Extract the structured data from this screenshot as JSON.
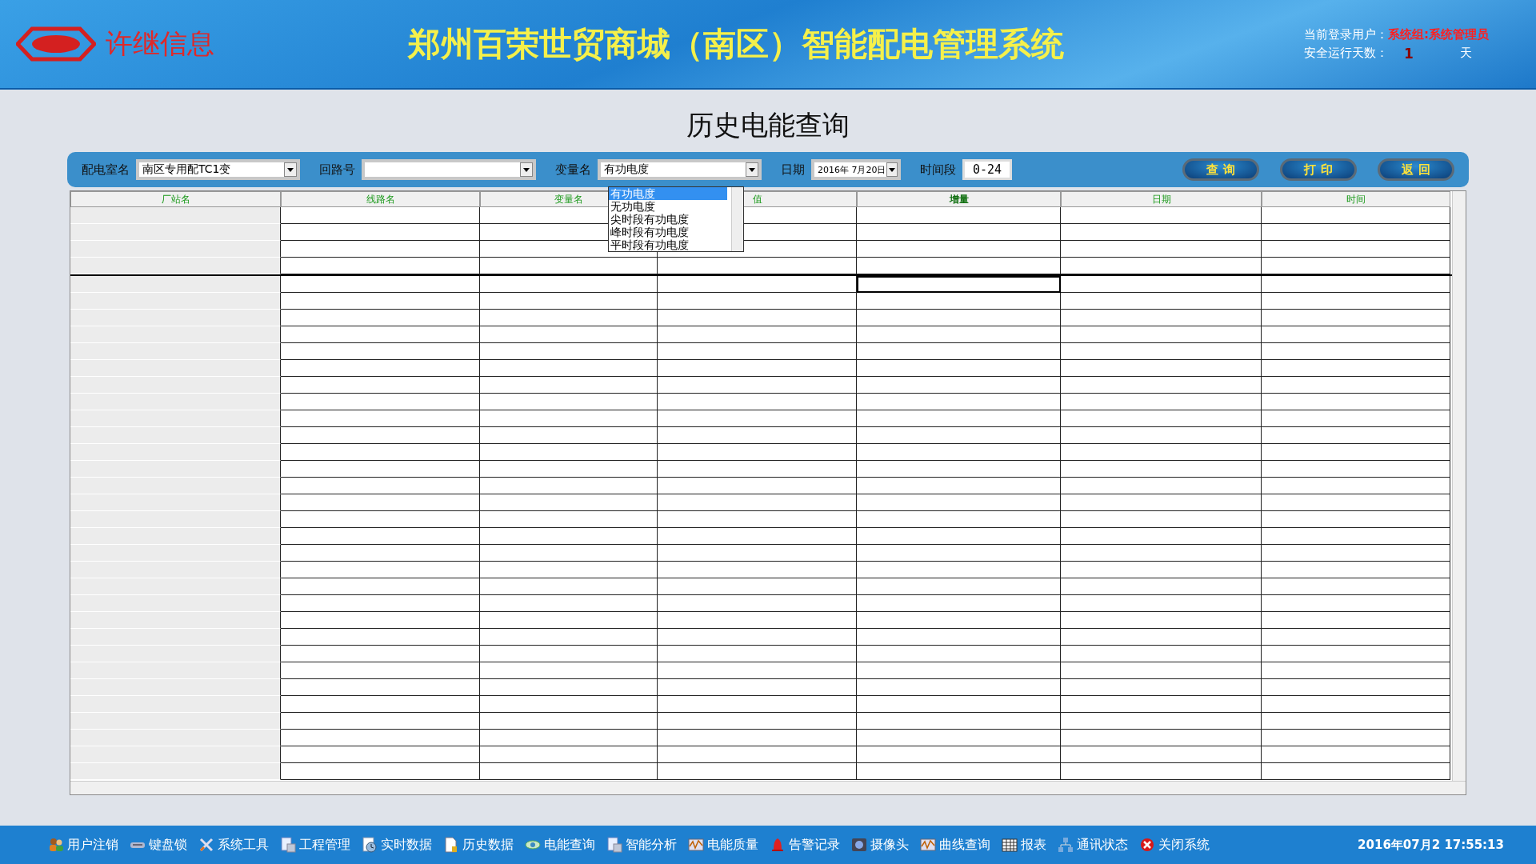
{
  "header": {
    "logo_text": "许继信息",
    "title": "郑州百荣世贸商城（南区）智能配电管理系统",
    "user_label": "当前登录用户：",
    "user_value": "系统组:系统管理员",
    "days_label": "安全运行天数：",
    "days_value": "1",
    "days_unit": "天"
  },
  "page_title": "历史电能查询",
  "filters": [
    {
      "kind": "select",
      "label": "配电室名",
      "value": "南区专用配TC1变"
    },
    {
      "kind": "select",
      "label": "回路号"
    },
    {
      "kind": "select",
      "label": "变量名",
      "value": "有功电度",
      "open": true,
      "options": [
        {
          "label": "有功电度",
          "selected": true
        },
        {
          "label": "无功电度",
          "selected": false
        },
        {
          "label": "尖时段有功电度",
          "selected": false
        },
        {
          "label": "峰时段有功电度",
          "selected": false
        },
        {
          "label": "平时段有功电度",
          "selected": false
        }
      ]
    },
    {
      "kind": "date",
      "label": "日期",
      "value": "2016年 7月20日"
    },
    {
      "kind": "text",
      "label": "时间段",
      "value": "0-24"
    }
  ],
  "buttons": [
    "查 询",
    "打 印",
    "返 回"
  ],
  "table": {
    "columns": [
      "厂站名",
      "线路名",
      "变量名",
      "值",
      "增量",
      "日期",
      "时间"
    ]
  },
  "taskbar": {
    "items": [
      {
        "label": "用户注销",
        "kind": "users"
      },
      {
        "label": "键盘锁",
        "kind": "keyboard"
      },
      {
        "label": "系统工具",
        "kind": "tools"
      },
      {
        "label": "工程管理",
        "kind": "doc"
      },
      {
        "label": "实时数据",
        "kind": "clock"
      },
      {
        "label": "历史数据",
        "kind": "page"
      },
      {
        "label": "电能查询",
        "kind": "eye"
      },
      {
        "label": "智能分析",
        "kind": "doc"
      },
      {
        "label": "电能质量",
        "kind": "wave"
      },
      {
        "label": "告警记录",
        "kind": "bell"
      },
      {
        "label": "摄像头",
        "kind": "camera"
      },
      {
        "label": "曲线查询",
        "kind": "wave"
      },
      {
        "label": "报表",
        "kind": "grid"
      },
      {
        "label": "通讯状态",
        "kind": "network"
      },
      {
        "label": "关闭系统",
        "kind": "close"
      }
    ],
    "clock": "2016年07月2 17:55:13"
  }
}
